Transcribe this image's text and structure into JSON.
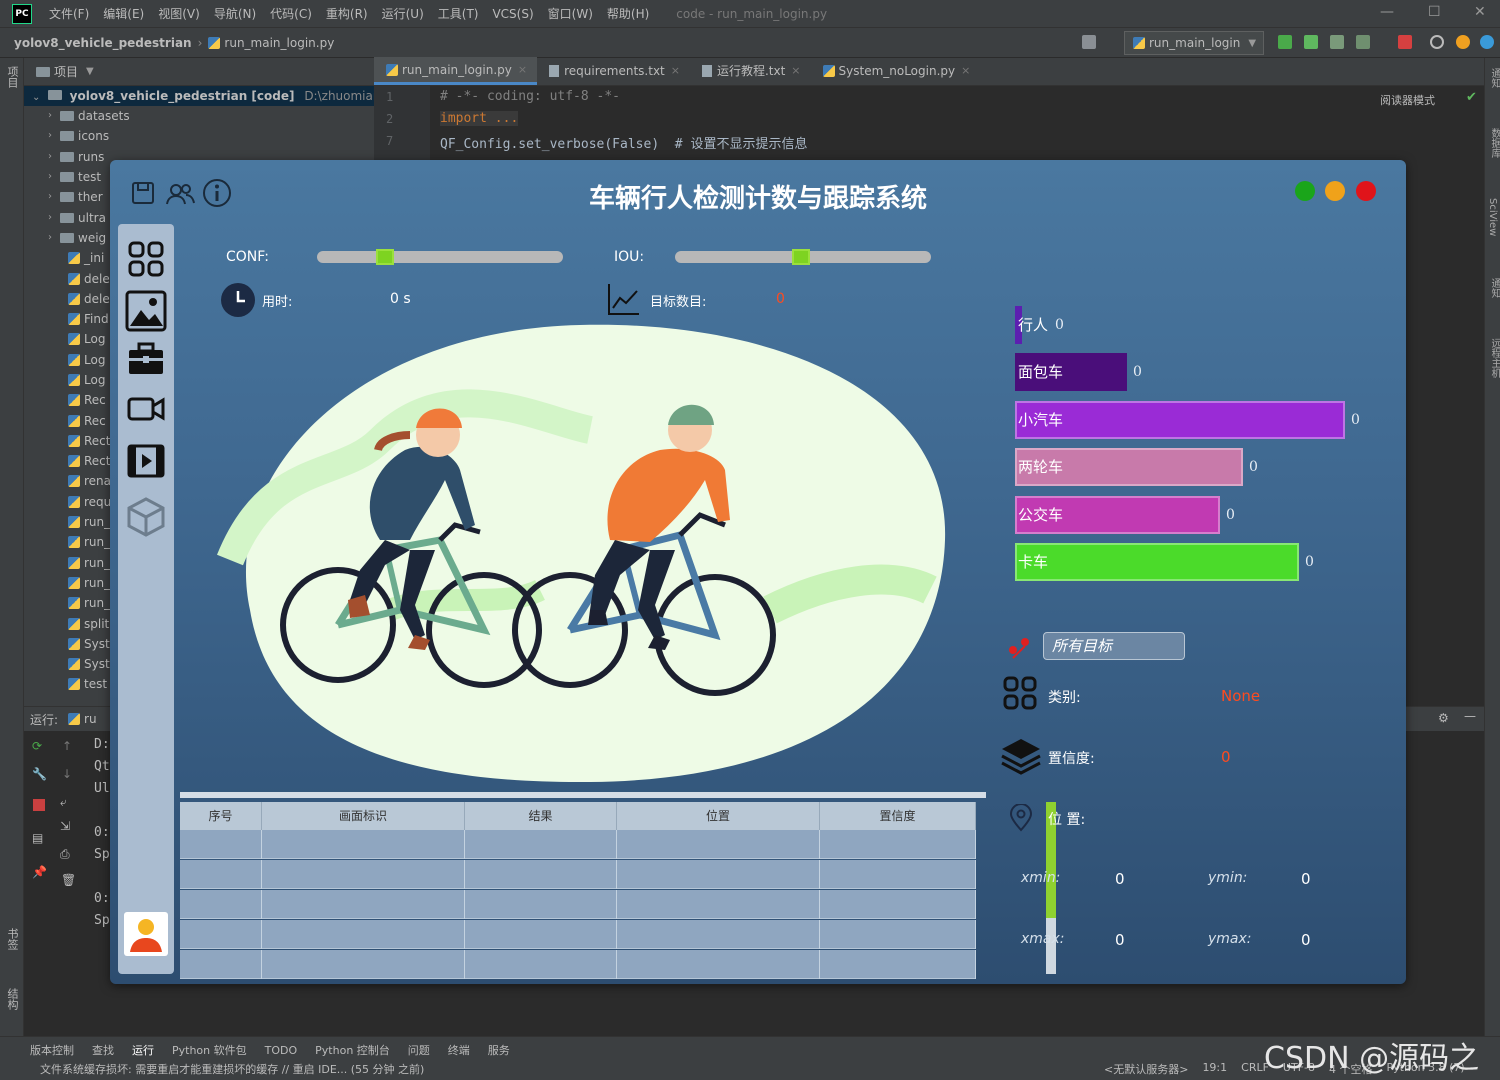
{
  "ide": {
    "logo": "PC",
    "menu": [
      "文件(F)",
      "编辑(E)",
      "视图(V)",
      "导航(N)",
      "代码(C)",
      "重构(R)",
      "运行(U)",
      "工具(T)",
      "VCS(S)",
      "窗口(W)",
      "帮助(H)"
    ],
    "window_title": "code - run_main_login.py",
    "breadcrumb": {
      "project": "yolov8_vehicle_pedestrian",
      "file": "run_main_login.py"
    },
    "run_config": "run_main_login",
    "left_stripe": {
      "project": "项目",
      "bookmarks": "书签",
      "structure": "结构"
    },
    "right_stripe": [
      "通知",
      "数据库",
      "SciView",
      "通知",
      "远程主机"
    ],
    "project_panel": {
      "title": "项目",
      "root": "yolov8_vehicle_pedestrian [code]",
      "root_path": "D:\\zhuomian\\yolo",
      "folders": [
        "datasets",
        "icons",
        "runs",
        "test",
        "ther",
        "ultra",
        "weig"
      ],
      "files": [
        "_ini",
        "dele",
        "dele",
        "Find",
        "Log",
        "Log",
        "Log",
        "Rec",
        "Rec",
        "Rect",
        "Rect",
        "rena",
        "requ",
        "run_",
        "run_",
        "run_",
        "run_",
        "run_",
        "split",
        "Syst",
        "Syst",
        "test"
      ]
    },
    "editor": {
      "tabs": [
        {
          "label": "run_main_login.py",
          "active": true
        },
        {
          "label": "requirements.txt",
          "active": false
        },
        {
          "label": "运行教程.txt",
          "active": false
        },
        {
          "label": "System_noLogin.py",
          "active": false
        }
      ],
      "line_numbers": [
        "1",
        "2",
        "7"
      ],
      "code": [
        "# -*- coding: utf-8 -*-",
        "import ...",
        "QF_Config.set_verbose(False)  # 设置不显示提示信息"
      ],
      "reader_mode": "阅读器模式"
    },
    "run_panel": {
      "label": "运行:",
      "config": "ru",
      "lines": [
        "D:",
        "Qt",
        "Ul",
        "0:",
        "Sp",
        "0:",
        "Sp"
      ]
    },
    "status": {
      "tool_tabs": [
        "版本控制",
        "查找",
        "运行",
        "Python 软件包",
        "TODO",
        "Python 控制台",
        "问题",
        "终端",
        "服务"
      ],
      "message": "文件系统缓存损坏: 需要重启才能重建损坏的缓存 // 重启 IDE... (55 分钟 之前)",
      "right": [
        "<无默认服务器>",
        "19:1",
        "CRLF",
        "UTF-8",
        "4 个空格",
        "Python 3.8 (7)"
      ]
    },
    "watermark": "CSDN @源码之家"
  },
  "app": {
    "title": "车辆行人检测计数与跟踪系统",
    "conf_label": "CONF:",
    "conf_value": 0.26,
    "iou_label": "IOU:",
    "iou_value": 0.49,
    "time_label": "用时:",
    "time_value": "0 s",
    "count_label": "目标数目:",
    "count_value": "0",
    "classes": [
      {
        "name": "行人",
        "count": "0",
        "color": "#5c1fb0",
        "fill": 0.02
      },
      {
        "name": "面包车",
        "count": "0",
        "color": "#4a0e7a",
        "fill": 0.34
      },
      {
        "name": "小汽车",
        "count": "0",
        "color": "#9a2bd6",
        "fill": 1.0
      },
      {
        "name": "两轮车",
        "count": "0",
        "color": "#c87aaa",
        "fill": 0.69
      },
      {
        "name": "公交车",
        "count": "0",
        "color": "#c13ab2",
        "fill": 0.62
      },
      {
        "name": "卡车",
        "count": "0",
        "color": "#4bdb2a",
        "fill": 0.86
      }
    ],
    "target_select": "所有目标",
    "category_label": "类别:",
    "category_value": "None",
    "confidence_label": "置信度:",
    "confidence_value": "0",
    "position_label": "位 置:",
    "coords": {
      "xmin_label": "xmin:",
      "xmin": "0",
      "ymin_label": "ymin:",
      "ymin": "0",
      "xmax_label": "xmax:",
      "xmax": "0",
      "ymax_label": "ymax:",
      "ymax": "0"
    },
    "table": {
      "headers": [
        "序号",
        "画面标识",
        "结果",
        "位置",
        "置信度"
      ],
      "rows": 5
    },
    "lights": [
      "#1aa51a",
      "#f0a21a",
      "#e0141a"
    ]
  }
}
